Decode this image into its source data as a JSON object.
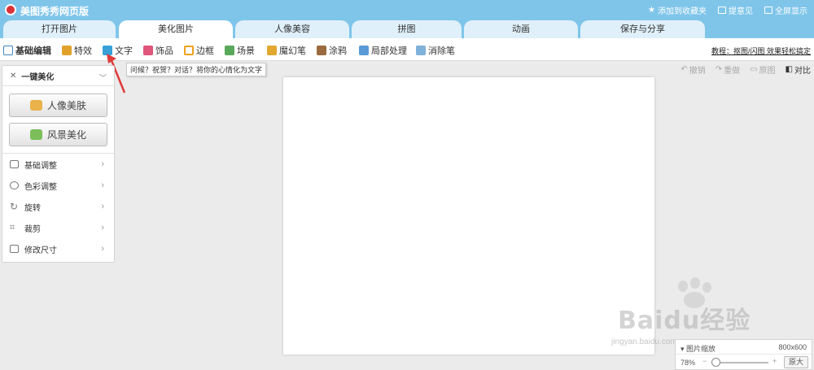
{
  "window": {
    "app_title": "美图秀秀网页版",
    "top_links": [
      {
        "label": "添加到收藏夹",
        "icon": "star-icon"
      },
      {
        "label": "提意见",
        "icon": "comment-icon"
      },
      {
        "label": "全屏显示",
        "icon": "fullscreen-icon"
      }
    ]
  },
  "tabs": [
    {
      "label": "打开图片",
      "active": false
    },
    {
      "label": "美化图片",
      "active": true
    },
    {
      "label": "人像美容",
      "active": false
    },
    {
      "label": "拼图",
      "active": false
    },
    {
      "label": "动画",
      "active": false
    },
    {
      "label": "保存与分享",
      "active": false
    }
  ],
  "toolbar": {
    "items": [
      {
        "label": "基础编辑",
        "icon": "edit-icon",
        "color": "#3d86c6"
      },
      {
        "label": "特效",
        "icon": "effects-icon",
        "color": "#e1a22c"
      },
      {
        "label": "文字",
        "icon": "text-icon",
        "color": "#3aa0d8"
      },
      {
        "label": "饰品",
        "icon": "bow-icon",
        "color": "#e0567a"
      },
      {
        "label": "边框",
        "icon": "frame-icon",
        "color": "#f0a21c"
      },
      {
        "label": "场景",
        "icon": "scene-icon",
        "color": "#5aa95a"
      },
      {
        "label": "魔幻笔",
        "icon": "magic-pen-icon",
        "color": "#e2a72e"
      },
      {
        "label": "涂鸦",
        "icon": "brush-icon",
        "color": "#9b6b3f"
      },
      {
        "label": "局部处理",
        "icon": "local-edit-icon",
        "color": "#5a9ad6"
      },
      {
        "label": "消除笔",
        "icon": "eraser-icon",
        "color": "#7fb2db"
      }
    ],
    "tutorial_link": "教程：抠图/闪图 效果轻松搞定"
  },
  "tooltip": {
    "text": "问候？祝贺？对话？将你的心情化为文字"
  },
  "left_panel": {
    "header": "一键美化",
    "buttons": [
      {
        "label": "人像美肤",
        "icon": "portrait-icon"
      },
      {
        "label": "风景美化",
        "icon": "landscape-icon"
      }
    ],
    "menu": [
      {
        "label": "基础调整",
        "icon": "sliders-icon"
      },
      {
        "label": "色彩调整",
        "icon": "palette-icon"
      },
      {
        "label": "旋转",
        "icon": "rotate-icon"
      },
      {
        "label": "裁剪",
        "icon": "crop-icon"
      },
      {
        "label": "修改尺寸",
        "icon": "resize-icon"
      }
    ]
  },
  "undo_bar": [
    {
      "label": "撤销",
      "icon": "undo-icon",
      "enabled": false
    },
    {
      "label": "重做",
      "icon": "redo-icon",
      "enabled": false
    },
    {
      "label": "原图",
      "icon": "original-icon",
      "enabled": false
    },
    {
      "label": "对比",
      "icon": "compare-icon",
      "enabled": true
    }
  ],
  "zoom": {
    "label": "图片缩放",
    "size": "800x600",
    "percent": "78%",
    "minus": "−",
    "plus": "+",
    "original_button": "原大"
  },
  "watermark": {
    "text": "Baidu经验",
    "url": "jingyan.baidu.com"
  }
}
